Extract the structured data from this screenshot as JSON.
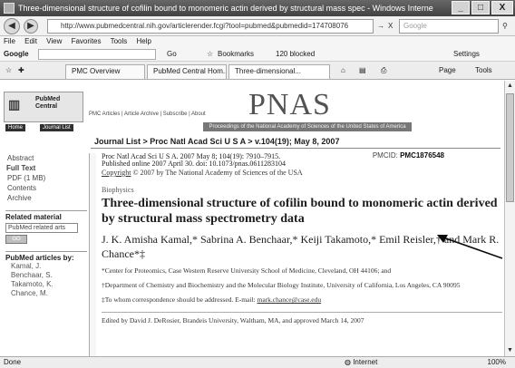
{
  "window": {
    "title": "Three-dimensional structure of cofilin bound to monomeric actin derived by structural mass spec - Windows Interne",
    "min_label": "_",
    "max_label": "□",
    "close_label": "X"
  },
  "address_bar": {
    "back_icon": "back-arrow-icon",
    "forward_icon": "forward-arrow-icon",
    "url": "http://www.pubmedcentral.nih.gov/articlerender.fcgi?tool=pubmed&pubmedid=174708076",
    "go_label": "→",
    "close_label": "X",
    "search_placeholder": "Google"
  },
  "menu": [
    "File",
    "Edit",
    "View",
    "Favorites",
    "Tools",
    "Help"
  ],
  "google_toolbar": {
    "label": "Google",
    "go_label": "Go",
    "bookmarks_label": "Bookmarks",
    "blocked_label": "120 blocked",
    "settings_label": "Settings"
  },
  "tabs": [
    {
      "label": "PMC Overview"
    },
    {
      "label": "PubMed Central Hom..."
    },
    {
      "label": "Three-dimensional..."
    }
  ],
  "tab_tools": {
    "page_label": "Page",
    "tools_label": "Tools"
  },
  "header": {
    "logo_name": "PubMed Central",
    "tag1": "Home",
    "tag2": "Journal List",
    "links": "PMC Articles | Article Archive | Subscribe | About",
    "journal": "PNAS",
    "strip": "Proceedings of the National Academy of Sciences of the United States of America"
  },
  "breadcrumb": "Journal List > Proc Natl Acad Sci U S A > v.104(19); May 8, 2007",
  "left_nav": {
    "links": [
      "Abstract",
      "Full Text",
      "PDF (1 MB)",
      "Contents",
      "Archive"
    ],
    "active_index": 1,
    "related_title": "Related material",
    "related_select": "PubMed related arts",
    "go_label": "GO",
    "published_title": "PubMed articles by:",
    "authors": [
      "Kamal, J.",
      "Benchaar, S.",
      "Takamoto, K.",
      "Chance, M."
    ]
  },
  "article": {
    "cite_line1": "Proc Natl Acad Sci U S A. 2007 May 8; 104(19): 7910–7915.",
    "cite_line2": "Published online 2007 April 30. doi: 10.1073/pnas.0611283104",
    "copyright_link": "Copyright",
    "copyright_rest": " © 2007 by The National Academy of Sciences of the USA",
    "pmcid_label": "PMCID:",
    "pmcid_value": "PMC1876548",
    "category": "Biophysics",
    "title": "Three-dimensional structure of cofilin bound to monomeric actin derived by structural mass spectrometry data",
    "authors": "J. K. Amisha Kamal,* Sabrina A. Benchaar,* Keiji Takamoto,* Emil Reisler,† and Mark R. Chance*‡",
    "affil1": "*Center for Proteomics, Case Western Reserve University School of Medicine, Cleveland, OH 44106; and",
    "affil2": "†Department of Chemistry and Biochemistry and the Molecular Biology Institute, University of California, Los Angeles, CA 90095",
    "correspondence_prefix": "‡To whom correspondence should be addressed. E-mail: ",
    "correspondence_email": "mark.chance@case.edu",
    "edited": "Edited by David J. DeRosier, Brandeis University, Waltham, MA, and approved March 14, 2007"
  },
  "status": {
    "left": "Done",
    "zone": "Internet",
    "zoom": "100%"
  },
  "colors": {
    "title_bar": "#4a5668",
    "pnas_gray": "#555555"
  }
}
